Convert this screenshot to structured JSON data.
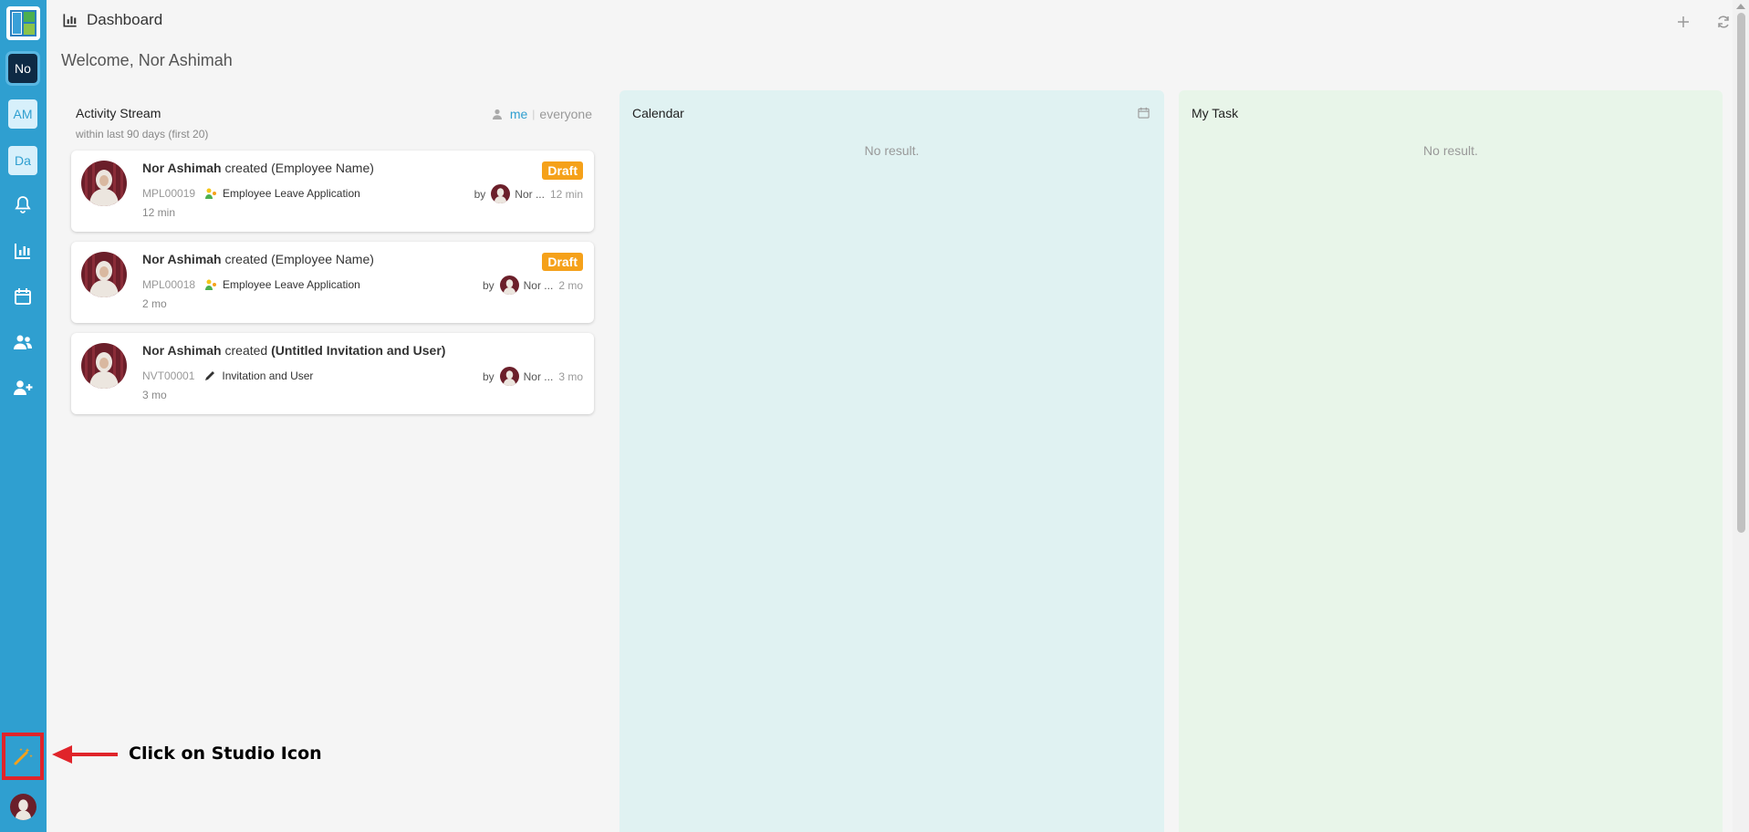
{
  "sidebar": {
    "workspaces": [
      "No",
      "AM",
      "Da"
    ],
    "icons": [
      "bell-icon",
      "chart-icon",
      "calendar-icon",
      "users-icon",
      "user-plus-icon"
    ],
    "studio_icon": "studio-wand-icon"
  },
  "header": {
    "title": "Dashboard",
    "welcome": "Welcome, Nor Ashimah",
    "actions": [
      "plus-icon",
      "refresh-icon"
    ]
  },
  "activity": {
    "title": "Activity Stream",
    "filter_me": "me",
    "filter_everyone": "everyone",
    "subtitle": "within last 90 days (first 20)",
    "items": [
      {
        "user": "Nor Ashimah",
        "action": " created ",
        "target": "(Employee Name)",
        "badge": "Draft",
        "code": "MPL00019",
        "app": "Employee Leave Application",
        "by_label": "by",
        "by_name": "Nor ...",
        "ago": "12 min",
        "time": "12 min"
      },
      {
        "user": "Nor Ashimah",
        "action": " created ",
        "target": "(Employee Name)",
        "badge": "Draft",
        "code": "MPL00018",
        "app": "Employee Leave Application",
        "by_label": "by",
        "by_name": "Nor ...",
        "ago": "2 mo",
        "time": "2 mo"
      },
      {
        "user": "Nor Ashimah",
        "action": " created ",
        "target": "(Untitled Invitation and User)",
        "badge": "",
        "code": "NVT00001",
        "app": "Invitation and User",
        "by_label": "by",
        "by_name": "Nor ...",
        "ago": "3 mo",
        "time": "3 mo"
      }
    ]
  },
  "calendar": {
    "title": "Calendar",
    "empty": "No result."
  },
  "task": {
    "title": "My Task",
    "empty": "No result."
  },
  "annotation": {
    "text": "Click on Studio Icon"
  },
  "colors": {
    "sidebar": "#2f9fd0",
    "badge": "#f5a11a",
    "highlight": "#e0242a",
    "calendar_bg": "#e0f2f2",
    "task_bg": "#e8f5e9"
  }
}
